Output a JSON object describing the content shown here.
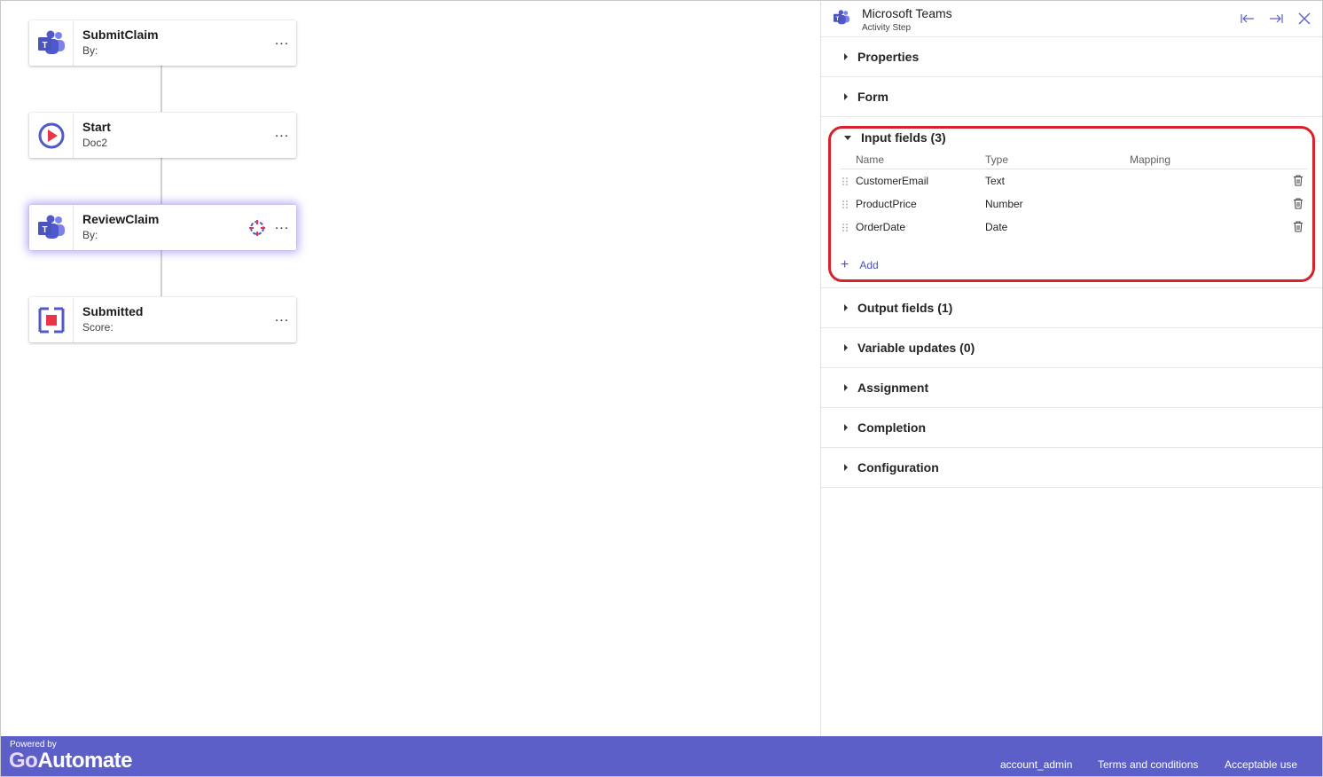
{
  "flow": {
    "nodes": [
      {
        "title": "SubmitClaim",
        "subtitle": "By:",
        "icon": "teams-icon",
        "menu": "..."
      },
      {
        "title": "Start",
        "subtitle": "Doc2",
        "icon": "start-play-icon",
        "menu": "..."
      },
      {
        "title": "ReviewClaim",
        "subtitle": "By:",
        "icon": "teams-icon",
        "menu": "...",
        "selected": true,
        "badge": "target-icon"
      },
      {
        "title": "Submitted",
        "subtitle": "Score:",
        "icon": "stop-square-icon",
        "menu": "..."
      }
    ]
  },
  "panel": {
    "title": "Microsoft Teams",
    "subtitle": "Activity Step",
    "sections": {
      "properties": "Properties",
      "form": "Form",
      "input_fields": "Input fields (3)",
      "output_fields": "Output fields (1)",
      "variable_updates": "Variable updates (0)",
      "assignment": "Assignment",
      "completion": "Completion",
      "configuration": "Configuration"
    },
    "input_table": {
      "headers": {
        "name": "Name",
        "type": "Type",
        "mapping": "Mapping"
      },
      "rows": [
        {
          "name": "CustomerEmail",
          "type": "Text",
          "mapping": ""
        },
        {
          "name": "ProductPrice",
          "type": "Number",
          "mapping": ""
        },
        {
          "name": "OrderDate",
          "type": "Date",
          "mapping": ""
        }
      ],
      "add_label": "Add"
    }
  },
  "footer": {
    "powered_by": "Powered by",
    "brand_go": "Go",
    "brand_rest": "Automate",
    "links": [
      "account_admin",
      "Terms and conditions",
      "Acceptable use"
    ]
  },
  "colors": {
    "accent": "#5b5fc7",
    "highlight": "#d9212c",
    "teams_purple": "#5059c9",
    "start_red": "#e8354a"
  }
}
